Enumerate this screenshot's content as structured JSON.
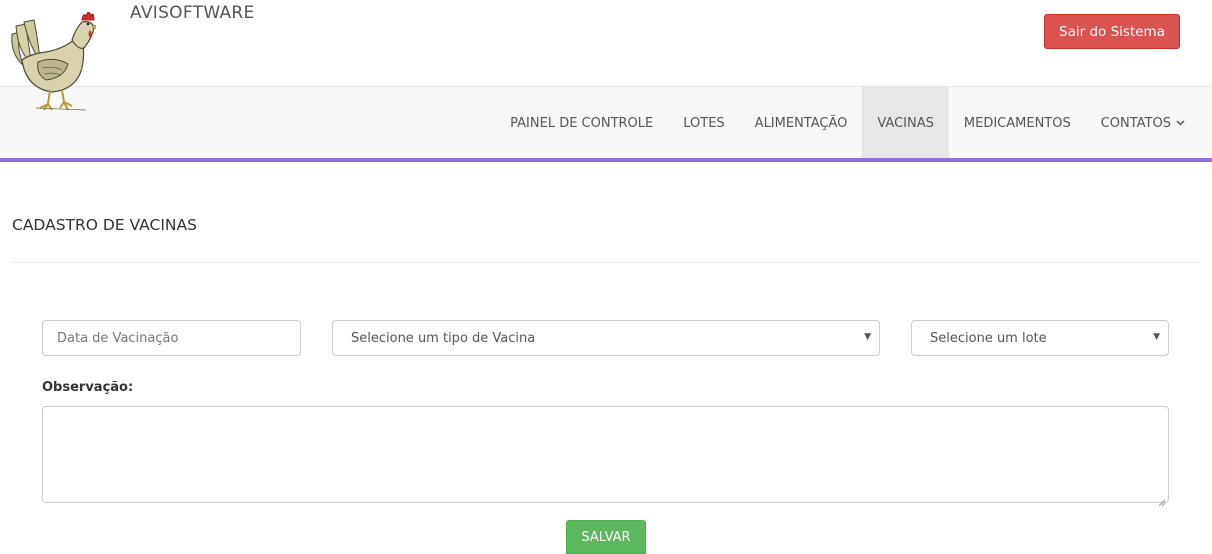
{
  "header": {
    "brand": "AVISOFTWARE",
    "logout_label": "Sair do Sistema",
    "logo_icon": "chicken-logo-icon"
  },
  "nav": {
    "items": [
      {
        "label": "PAINEL DE CONTROLE"
      },
      {
        "label": "LOTES"
      },
      {
        "label": "ALIMENTAÇÃO"
      },
      {
        "label": "VACINAS",
        "active": true
      },
      {
        "label": "MEDICAMENTOS"
      },
      {
        "label": "CONTATOS",
        "dropdown": true
      }
    ]
  },
  "form": {
    "title": "CADASTRO DE VACINAS",
    "date_placeholder": "Data de Vacinação",
    "vaccine_select": "Selecione um tipo de Vacina",
    "lot_select": "Selecione um lote",
    "obs_label": "Observação:",
    "save_label": "SALVAR"
  },
  "colors": {
    "accent_underline": "#9370db",
    "logout": "#d9534f",
    "save": "#5cb85c"
  }
}
